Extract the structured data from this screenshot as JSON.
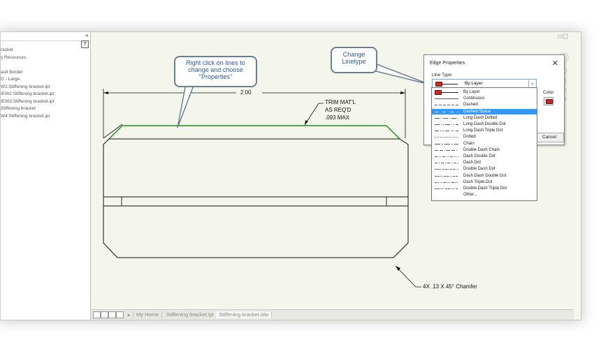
{
  "browser": {
    "items": [
      "racket",
      "y Resources",
      "",
      "ault Border",
      "D - Large",
      "W1:Stiffening bracket.ipt",
      "IEW2:Stiffening bracket.ipt",
      "IEW3:Stiffening bracket.ipt",
      "Stiffening bracket",
      "W4:Stiffening bracket.ipt"
    ],
    "help": "?",
    "close": "×"
  },
  "callouts": {
    "right_click": "Right click on lines to change and choose \"Properties\"",
    "change_linetype": "Change Linetype"
  },
  "drawing": {
    "dimension": "2.00",
    "note_line1": "TRIM MAT'L",
    "note_line2": "AS REQ'D",
    "note_line3": ".093 MAX",
    "chamfer": "4X .13 X 45° Chamfer"
  },
  "dialog": {
    "title": "Edge Properties",
    "close": "✕",
    "line_type_label": "Line Type",
    "selected_value": "By Layer",
    "color_label": "Color",
    "cancel_label": "Cancel",
    "options": [
      {
        "label": "By Layer",
        "style": "bylayer"
      },
      {
        "label": "Continuous",
        "style": "solid"
      },
      {
        "label": "Dashed",
        "style": "dashed"
      },
      {
        "label": "Dashed Space",
        "style": "dashedspace"
      },
      {
        "label": "Long Dash Dotted",
        "style": "ldd"
      },
      {
        "label": "Long Dash Double Dot",
        "style": "lddd"
      },
      {
        "label": "Long Dash Triple Dot",
        "style": "ldtd"
      },
      {
        "label": "Dotted",
        "style": "dotted"
      },
      {
        "label": "Chain",
        "style": "chain"
      },
      {
        "label": "Double Dash Chain",
        "style": "ddc"
      },
      {
        "label": "Dash Double Dot",
        "style": "ddd"
      },
      {
        "label": "Dash Dot",
        "style": "dd"
      },
      {
        "label": "Double Dash Dot",
        "style": "dddot"
      },
      {
        "label": "Dash Dash Double Dot",
        "style": "dddd"
      },
      {
        "label": "Dash Triple Dot",
        "style": "dtd"
      },
      {
        "label": "Double Dash Triple Dot",
        "style": "ddtd"
      },
      {
        "label": "Other...",
        "style": "none"
      }
    ],
    "selected_index": 3
  },
  "tabs": {
    "home": "My Home",
    "part": "Stiffening bracket.ipt",
    "drawing": "Stiffening bracket.idw"
  },
  "colors": {
    "highlight_edge": "#1a8f1a",
    "selection": "#3399ff",
    "callout_text": "#2a5b8c",
    "color_swatch": "#c62828"
  }
}
